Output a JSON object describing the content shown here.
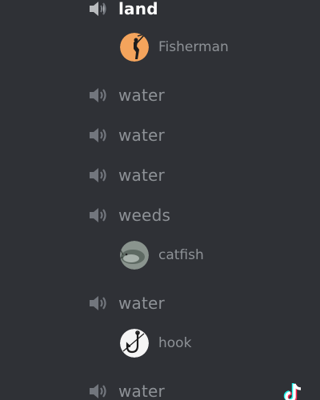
{
  "voice_channels": [
    {
      "label": "land",
      "active": true
    },
    {
      "label": "water"
    },
    {
      "label": "water"
    },
    {
      "label": "water"
    },
    {
      "label": "weeds"
    },
    {
      "label": "water"
    },
    {
      "label": "water"
    }
  ],
  "users": [
    {
      "name": "Fisherman",
      "avatar": "fisherman-silhouette-avatar"
    },
    {
      "name": "catfish",
      "avatar": "catfish-photo-avatar"
    },
    {
      "name": "hook",
      "avatar": "fishing-hook-avatar"
    }
  ],
  "icons": {
    "channel": "speaker-icon",
    "watermark": "tiktok-logo"
  },
  "colors": {
    "background": "#2f3136",
    "channel_text": "#8e9297",
    "active_text": "#ffffff",
    "fisherman_avatar_bg": "#f4a45c"
  }
}
